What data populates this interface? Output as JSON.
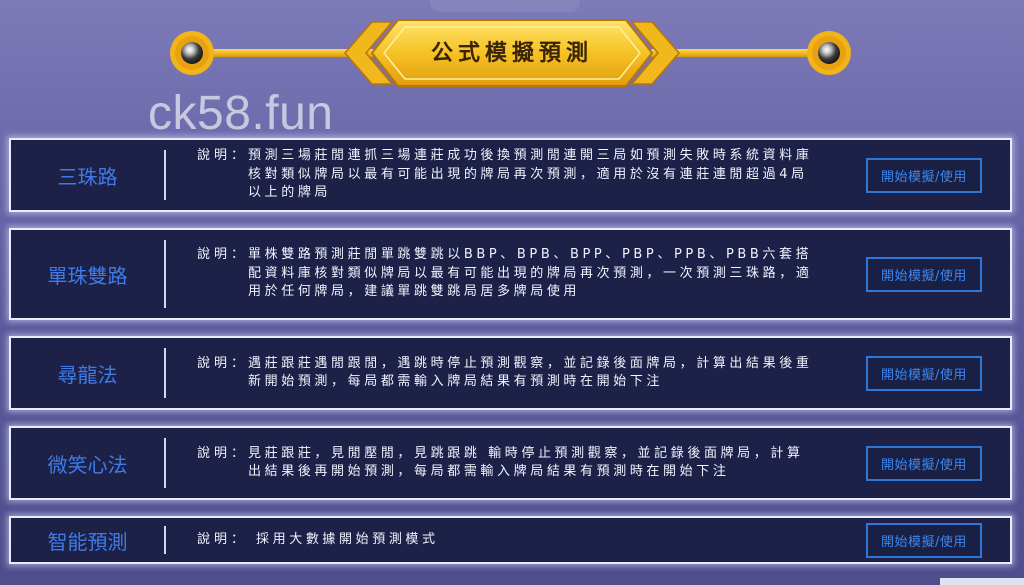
{
  "header": {
    "title": "公式模擬預測"
  },
  "watermark": "ck58.fun",
  "desc_label": "說明：",
  "rows": [
    {
      "title": "三珠路",
      "description": "預測三場莊閒連抓三場連莊成功後換預測閒連開三局如預測失敗時系統資料庫核對類似牌局以最有可能出現的牌局再次預測，適用於沒有連莊連閒超過4局以上的牌局",
      "button": "開始模擬/使用"
    },
    {
      "title": "單珠雙路",
      "description": "單株雙路預測莊閒單跳雙跳以BBP、BPB、BPP、PBP、PPB、PBB六套搭配資料庫核對類似牌局以最有可能出現的牌局再次預測，一次預測三珠路，適用於任何牌局，建議單跳雙跳局居多牌局使用",
      "button": "開始模擬/使用"
    },
    {
      "title": "尋龍法",
      "description": "遇莊跟莊遇閒跟閒，遇跳時停止預測觀察，並記錄後面牌局，計算出結果後重新開始預測，每局都需輸入牌局結果有預測時在開始下注",
      "button": "開始模擬/使用"
    },
    {
      "title": "微笑心法",
      "description": "見莊跟莊，見閒壓閒，見跳跟跳 輸時停止預測觀察，並記錄後面牌局，計算出結果後再開始預測，每局都需輸入牌局結果有預測時在開始下注",
      "button": "開始模擬/使用"
    },
    {
      "title": "智能預測",
      "description": "採用大數據開始預測模式",
      "button": "開始模擬/使用"
    }
  ],
  "colors": {
    "gold": "#f0b81c",
    "row_bg": "#1d2147",
    "title_blue": "#3f7be8",
    "button_border": "#2c78d8"
  },
  "icons": {
    "left_orb": "gold-orb-icon",
    "right_orb": "gold-orb-icon"
  }
}
